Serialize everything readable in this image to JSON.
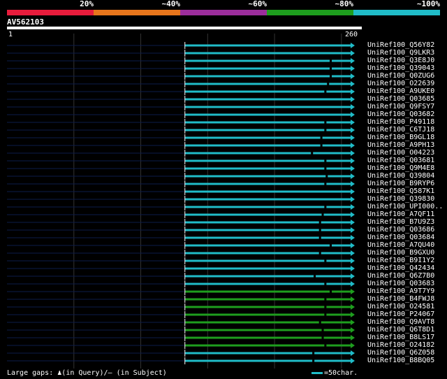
{
  "colors": {
    "seg_20": "#e81c3c",
    "seg_40": "#e8761c",
    "seg_60": "#9c2e9c",
    "seg_80": "#1e9e1e",
    "seg_100": "#20bcc8",
    "guide_line": "#0d1b4a",
    "grid_line": "#333333"
  },
  "legend": [
    "20%",
    "~40%",
    "~60%",
    "~80%",
    "~100%"
  ],
  "query": {
    "id": "AV562103",
    "start_label": "1",
    "end_label": "260",
    "length": 260
  },
  "hits": [
    {
      "name": "UniRef100_Q56Y82",
      "identity": "~100%",
      "qstart": 133,
      "qend": 260,
      "mark": null
    },
    {
      "name": "UniRef100_Q9LKR3",
      "identity": "~100%",
      "qstart": 133,
      "qend": 260,
      "mark": null
    },
    {
      "name": "UniRef100_Q3E8J0",
      "identity": "~100%",
      "qstart": 133,
      "qend": 260,
      "mark": 242
    },
    {
      "name": "UniRef100_Q39043",
      "identity": "~100%",
      "qstart": 133,
      "qend": 260,
      "mark": 242
    },
    {
      "name": "UniRef100_Q0ZUG6",
      "identity": "~100%",
      "qstart": 133,
      "qend": 260,
      "mark": 242
    },
    {
      "name": "UniRef100_O22639",
      "identity": "~100%",
      "qstart": 133,
      "qend": 260,
      "mark": 240
    },
    {
      "name": "UniRef100_A9UKE0",
      "identity": "~100%",
      "qstart": 133,
      "qend": 260,
      "mark": 238
    },
    {
      "name": "UniRef100_Q03685",
      "identity": "~100%",
      "qstart": 133,
      "qend": 260,
      "mark": null
    },
    {
      "name": "UniRef100_Q9FSY7",
      "identity": "~100%",
      "qstart": 133,
      "qend": 260,
      "mark": null
    },
    {
      "name": "UniRef100_Q03682",
      "identity": "~100%",
      "qstart": 133,
      "qend": 260,
      "mark": null
    },
    {
      "name": "UniRef100_P49118",
      "identity": "~100%",
      "qstart": 133,
      "qend": 260,
      "mark": 238
    },
    {
      "name": "UniRef100_C6TJ18",
      "identity": "~100%",
      "qstart": 133,
      "qend": 260,
      "mark": 238
    },
    {
      "name": "UniRef100_B9GL18",
      "identity": "~100%",
      "qstart": 133,
      "qend": 260,
      "mark": 235
    },
    {
      "name": "UniRef100_A9PH13",
      "identity": "~100%",
      "qstart": 133,
      "qend": 260,
      "mark": 235
    },
    {
      "name": "UniRef100_O04223",
      "identity": "~100%",
      "qstart": 133,
      "qend": 260,
      "mark": 228
    },
    {
      "name": "UniRef100_Q03681",
      "identity": "~100%",
      "qstart": 133,
      "qend": 260,
      "mark": 238
    },
    {
      "name": "UniRef100_Q9M4E8",
      "identity": "~100%",
      "qstart": 133,
      "qend": 260,
      "mark": 238
    },
    {
      "name": "UniRef100_Q39804",
      "identity": "~100%",
      "qstart": 133,
      "qend": 260,
      "mark": 239
    },
    {
      "name": "UniRef100_B9RYP6",
      "identity": "~100%",
      "qstart": 133,
      "qend": 260,
      "mark": 238
    },
    {
      "name": "UniRef100_Q587K1",
      "identity": "~100%",
      "qstart": 133,
      "qend": 260,
      "mark": null
    },
    {
      "name": "UniRef100_Q39830",
      "identity": "~100%",
      "qstart": 133,
      "qend": 260,
      "mark": null
    },
    {
      "name": "UniRef100_UPI000..",
      "identity": "~100%",
      "qstart": 133,
      "qend": 260,
      "mark": 238
    },
    {
      "name": "UniRef100_A7QF11",
      "identity": "~100%",
      "qstart": 133,
      "qend": 260,
      "mark": 236
    },
    {
      "name": "UniRef100_B7U9Z3",
      "identity": "~100%",
      "qstart": 133,
      "qend": 260,
      "mark": 234
    },
    {
      "name": "UniRef100_Q03686",
      "identity": "~100%",
      "qstart": 133,
      "qend": 260,
      "mark": 234
    },
    {
      "name": "UniRef100_Q03684",
      "identity": "~100%",
      "qstart": 133,
      "qend": 260,
      "mark": 234
    },
    {
      "name": "UniRef100_A7QU40",
      "identity": "~100%",
      "qstart": 133,
      "qend": 260,
      "mark": 242
    },
    {
      "name": "UniRef100_B9GXU0",
      "identity": "~100%",
      "qstart": 133,
      "qend": 260,
      "mark": 234
    },
    {
      "name": "UniRef100_B9I1Y2",
      "identity": "~100%",
      "qstart": 133,
      "qend": 260,
      "mark": 238
    },
    {
      "name": "UniRef100_Q42434",
      "identity": "~100%",
      "qstart": 133,
      "qend": 260,
      "mark": null
    },
    {
      "name": "UniRef100_Q6Z7B0",
      "identity": "~100%",
      "qstart": 133,
      "qend": 260,
      "mark": 230
    },
    {
      "name": "UniRef100_Q03683",
      "identity": "~100%",
      "qstart": 133,
      "qend": 260,
      "mark": 238
    },
    {
      "name": "UniRef100_A9T7Y9",
      "identity": "~80%",
      "qstart": 133,
      "qend": 260,
      "mark": 242
    },
    {
      "name": "UniRef100_B4FWJ8",
      "identity": "~80%",
      "qstart": 133,
      "qend": 260,
      "mark": 238
    },
    {
      "name": "UniRef100_O24581",
      "identity": "~80%",
      "qstart": 133,
      "qend": 260,
      "mark": 238
    },
    {
      "name": "UniRef100_P24067",
      "identity": "~80%",
      "qstart": 133,
      "qend": 260,
      "mark": 238
    },
    {
      "name": "UniRef100_Q9AVT8",
      "identity": "~80%",
      "qstart": 133,
      "qend": 260,
      "mark": 234
    },
    {
      "name": "UniRef100_Q6T8D1",
      "identity": "~80%",
      "qstart": 133,
      "qend": 260,
      "mark": 236
    },
    {
      "name": "UniRef100_B8LS17",
      "identity": "~80%",
      "qstart": 133,
      "qend": 260,
      "mark": 236
    },
    {
      "name": "UniRef100_O24182",
      "identity": "~80%",
      "qstart": 133,
      "qend": 260,
      "mark": 238
    },
    {
      "name": "UniRef100_Q6Z058",
      "identity": "~100%",
      "qstart": 133,
      "qend": 260,
      "mark": 229
    },
    {
      "name": "UniRef100_B8BQ05",
      "identity": "~100%",
      "qstart": 133,
      "qend": 260,
      "mark": 229
    }
  ],
  "footer": {
    "large_gaps_label": "Large gaps:",
    "query_gap_glyph": "♟",
    "query_gap_text": "(in Query)/",
    "subject_gap_glyph": "—",
    "subject_gap_text": " (in Subject)",
    "scale_text": "=50char."
  }
}
